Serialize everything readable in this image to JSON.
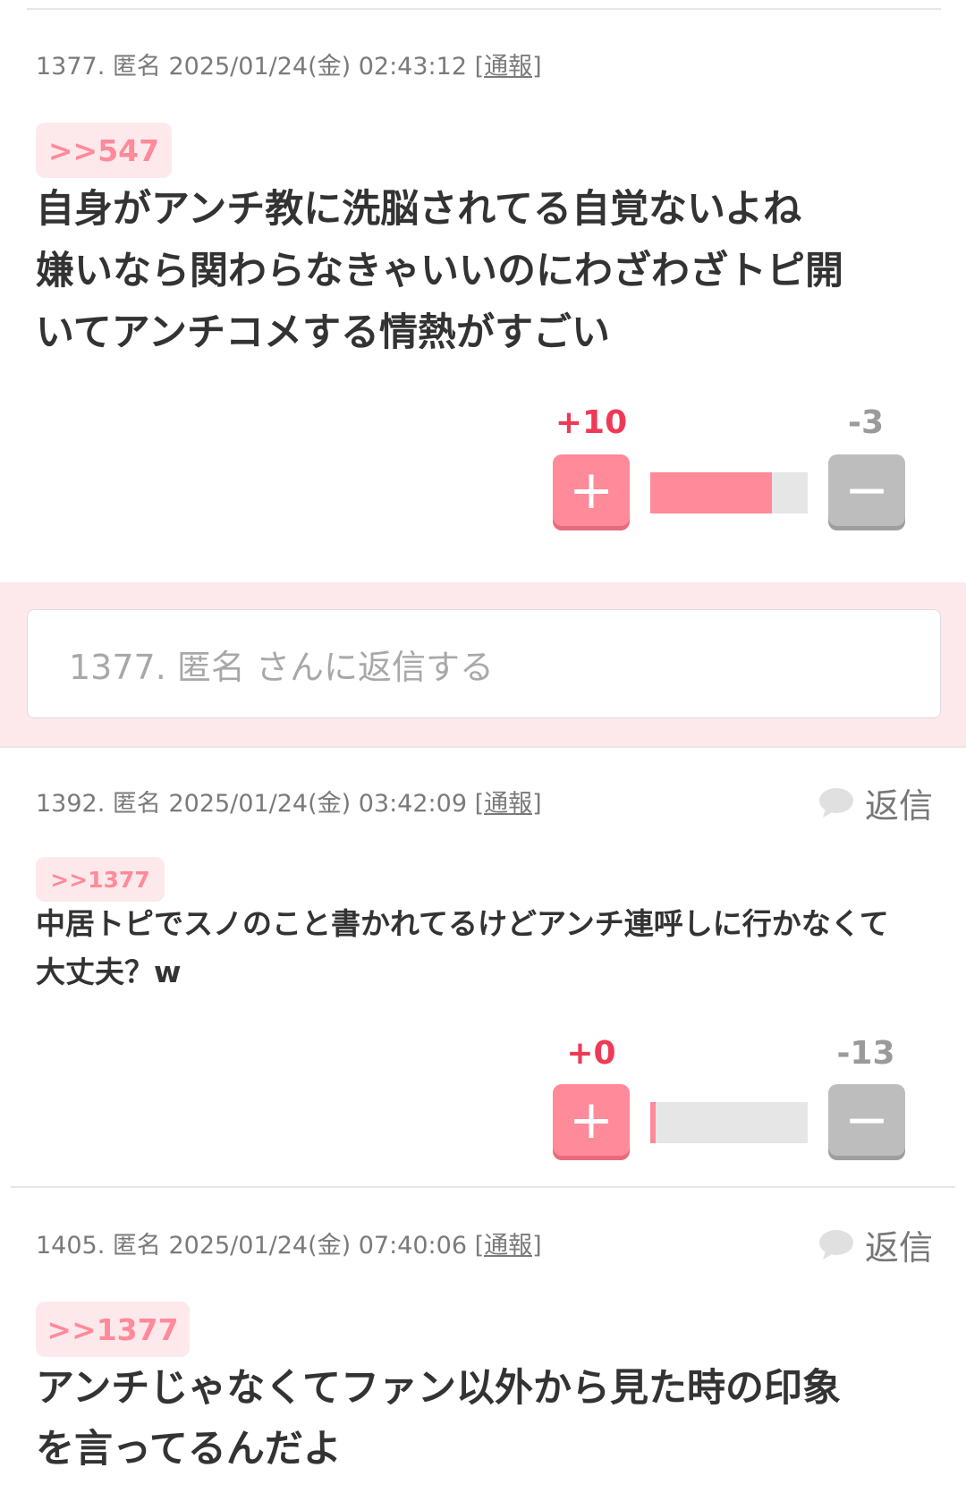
{
  "comments": [
    {
      "meta": "1377. 匿名 2025/01/24(金) 02:43:12 ",
      "report": "[通報]",
      "anchor": ">>547",
      "text": "自身がアンチ教に洗脳されてる自覚ないよね\n嫌いなら関わらなきゃいいのにわざわざトピ開\nいてアンチコメする情熱がすごい",
      "plus": "+10",
      "minus": "-3",
      "plus_ratio": 0.77
    },
    {
      "meta": "1392. 匿名 2025/01/24(金) 03:42:09 ",
      "report": "[通報]",
      "reply": "返信",
      "anchor": ">>1377",
      "text": "中居トピでスノのこと書かれてるけどアンチ連呼しに行かなくて\n大丈夫？w",
      "plus": "+0",
      "minus": "-13",
      "plus_ratio": 0.0
    },
    {
      "meta": "1405. 匿名 2025/01/24(金) 07:40:06 ",
      "report": "[通報]",
      "reply": "返信",
      "anchor": ">>1377",
      "text": "アンチじゃなくてファン以外から見た時の印象\nを言ってるんだよ"
    }
  ],
  "reply_form": {
    "placeholder": "1377. 匿名 さんに返信する"
  },
  "icons": {
    "plus": "plus-icon",
    "minus": "minus-icon",
    "reply": "speech-bubble-icon"
  },
  "colors": {
    "accent": "#ff8a99",
    "plus_count": "#ee3a56",
    "minus": "#bdbdbd",
    "reply_bg": "#fde9ec"
  }
}
